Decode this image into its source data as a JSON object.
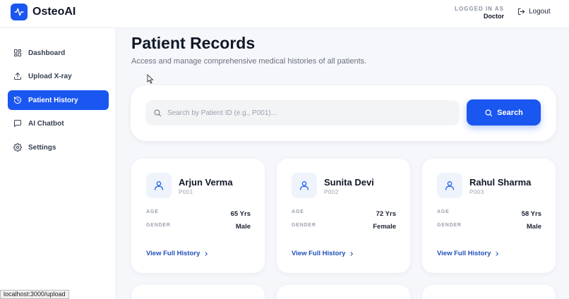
{
  "app": {
    "name": "OsteoAI",
    "brand_color": "#1a56f0"
  },
  "header": {
    "logged_in_label": "LOGGED IN AS",
    "role": "Doctor",
    "logout_label": "Logout"
  },
  "sidebar": {
    "items": [
      {
        "label": "Dashboard",
        "icon": "grid-icon",
        "active": false
      },
      {
        "label": "Upload X-ray",
        "icon": "upload-icon",
        "active": false
      },
      {
        "label": "Patient History",
        "icon": "history-icon",
        "active": true
      },
      {
        "label": "AI Chatbot",
        "icon": "chat-icon",
        "active": false
      },
      {
        "label": "Settings",
        "icon": "gear-icon",
        "active": false
      }
    ]
  },
  "main": {
    "title": "Patient Records",
    "subtitle": "Access and manage comprehensive medical histories of all patients.",
    "search": {
      "placeholder": "Search by Patient ID (e.g., P001)...",
      "value": "",
      "button_label": "Search"
    },
    "patients": [
      {
        "name": "Arjun Verma",
        "id": "P001",
        "age_label": "AGE",
        "age": "65 Yrs",
        "gender_label": "GENDER",
        "gender": "Male",
        "link": "View Full History"
      },
      {
        "name": "Sunita Devi",
        "id": "P002",
        "age_label": "AGE",
        "age": "72 Yrs",
        "gender_label": "GENDER",
        "gender": "Female",
        "link": "View Full History"
      },
      {
        "name": "Rahul Sharma",
        "id": "P003",
        "age_label": "AGE",
        "age": "58 Yrs",
        "gender_label": "GENDER",
        "gender": "Male",
        "link": "View Full History"
      }
    ]
  },
  "status_bar": {
    "url": "localhost:3000/upload"
  }
}
